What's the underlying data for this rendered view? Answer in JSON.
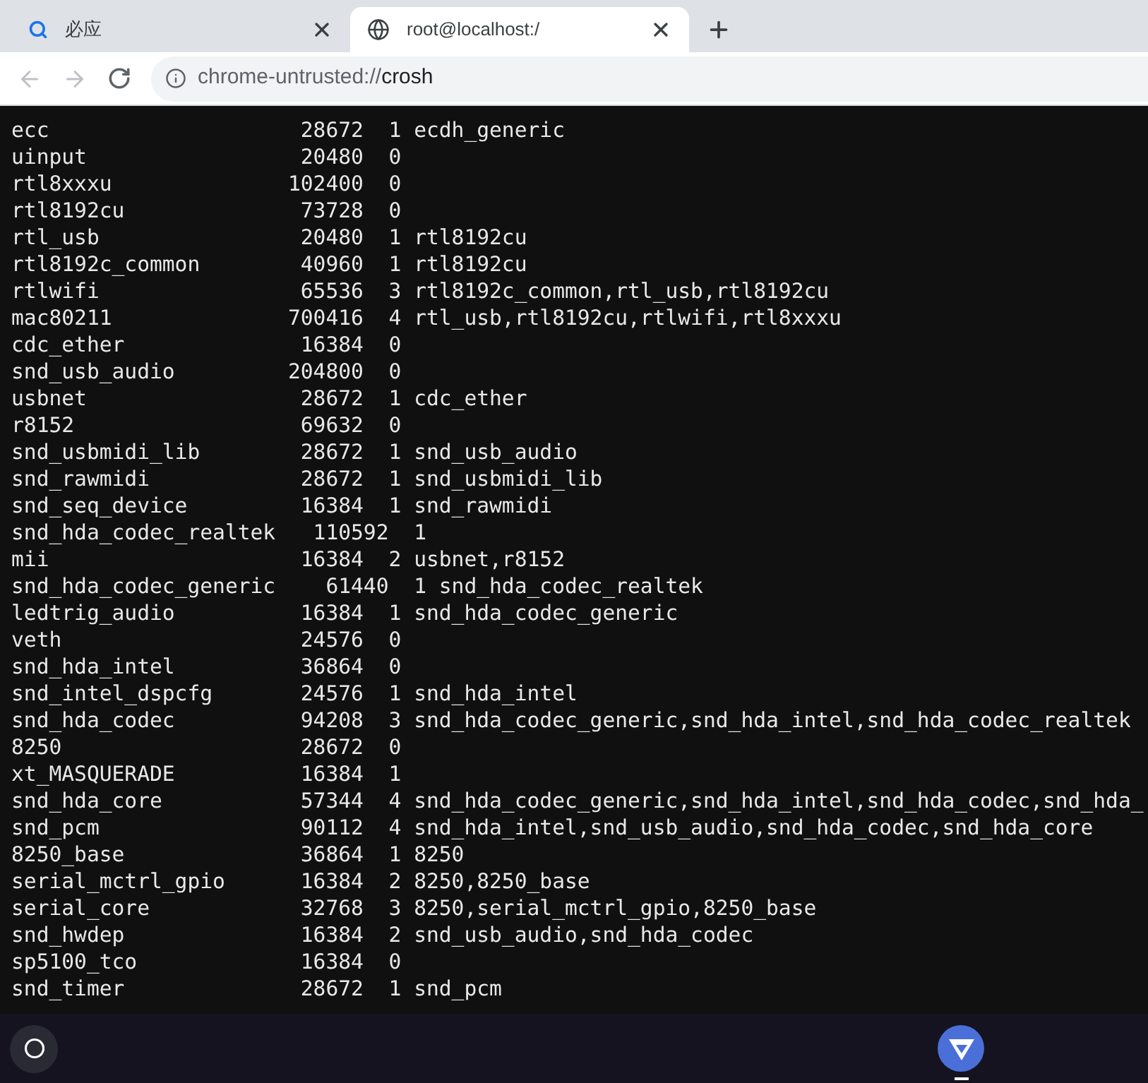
{
  "tabs": [
    {
      "title": "必应",
      "kind": "search",
      "selected": false
    },
    {
      "title": "root@localhost:/",
      "kind": "globe",
      "selected": true
    }
  ],
  "address_bar": {
    "scheme": "chrome-untrusted://",
    "host": "crosh"
  },
  "terminal": {
    "lines": [
      "ecc                    28672  1 ecdh_generic",
      "uinput                 20480  0",
      "rtl8xxxu              102400  0",
      "rtl8192cu              73728  0",
      "rtl_usb                20480  1 rtl8192cu",
      "rtl8192c_common        40960  1 rtl8192cu",
      "rtlwifi                65536  3 rtl8192c_common,rtl_usb,rtl8192cu",
      "mac80211              700416  4 rtl_usb,rtl8192cu,rtlwifi,rtl8xxxu",
      "cdc_ether              16384  0",
      "snd_usb_audio         204800  0",
      "usbnet                 28672  1 cdc_ether",
      "r8152                  69632  0",
      "snd_usbmidi_lib        28672  1 snd_usb_audio",
      "snd_rawmidi            28672  1 snd_usbmidi_lib",
      "snd_seq_device         16384  1 snd_rawmidi",
      "snd_hda_codec_realtek   110592  1",
      "mii                    16384  2 usbnet,r8152",
      "snd_hda_codec_generic    61440  1 snd_hda_codec_realtek",
      "ledtrig_audio          16384  1 snd_hda_codec_generic",
      "veth                   24576  0",
      "snd_hda_intel          36864  0",
      "snd_intel_dspcfg       24576  1 snd_hda_intel",
      "snd_hda_codec          94208  3 snd_hda_codec_generic,snd_hda_intel,snd_hda_codec_realtek",
      "8250                   28672  0",
      "xt_MASQUERADE          16384  1",
      "snd_hda_core           57344  4 snd_hda_codec_generic,snd_hda_intel,snd_hda_codec,snd_hda_",
      "snd_pcm                90112  4 snd_hda_intel,snd_usb_audio,snd_hda_codec,snd_hda_core",
      "8250_base              36864  1 8250",
      "serial_mctrl_gpio      16384  2 8250,8250_base",
      "serial_core            32768  3 8250,serial_mctrl_gpio,8250_base",
      "snd_hwdep              16384  2 snd_usb_audio,snd_hda_codec",
      "sp5100_tco             16384  0",
      "snd_timer              28672  1 snd_pcm"
    ]
  }
}
